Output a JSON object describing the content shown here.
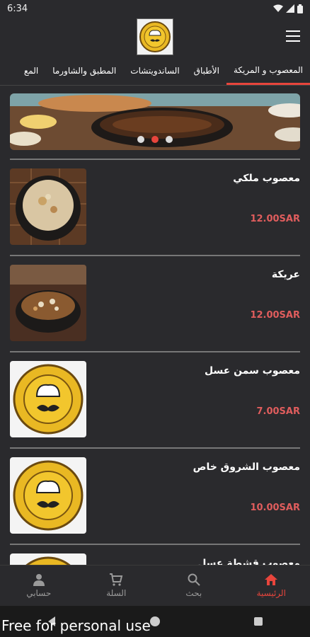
{
  "status": {
    "time": "6:34"
  },
  "header": {
    "logo": "restaurant-chef-logo",
    "menu_icon": "hamburger-icon"
  },
  "tabs": [
    {
      "label": "المعصوب و المريكة",
      "active": true
    },
    {
      "label": "الأطباق",
      "active": false
    },
    {
      "label": "الساندويتشات",
      "active": false
    },
    {
      "label": "المطبق والشاورما",
      "active": false
    },
    {
      "label": "المع",
      "active": false
    }
  ],
  "banner": {
    "slides": 3,
    "active_slide": 2
  },
  "items": [
    {
      "name": "معصوب ملكي",
      "price": "12.00SAR",
      "image": "food-photo"
    },
    {
      "name": "عريكة",
      "price": "12.00SAR",
      "image": "food-photo"
    },
    {
      "name": "معصوب سمن عسل",
      "price": "7.00SAR",
      "image": "logo-placeholder"
    },
    {
      "name": "معصوب الشروق خاص",
      "price": "10.00SAR",
      "image": "logo-placeholder"
    },
    {
      "name": "معصوب قشطة عسل",
      "price": "",
      "image": "logo-placeholder"
    }
  ],
  "bottom_nav": [
    {
      "label": "حسابي",
      "icon": "person-icon",
      "active": false
    },
    {
      "label": "السلة",
      "icon": "cart-icon",
      "active": false
    },
    {
      "label": "بحث",
      "icon": "search-icon",
      "active": false
    },
    {
      "label": "الرئيسية",
      "icon": "home-icon",
      "active": true
    }
  ],
  "watermark": "Free for personal use",
  "colors": {
    "accent": "#e8453c",
    "price": "#e05d5d",
    "background": "#2a2a2d"
  }
}
